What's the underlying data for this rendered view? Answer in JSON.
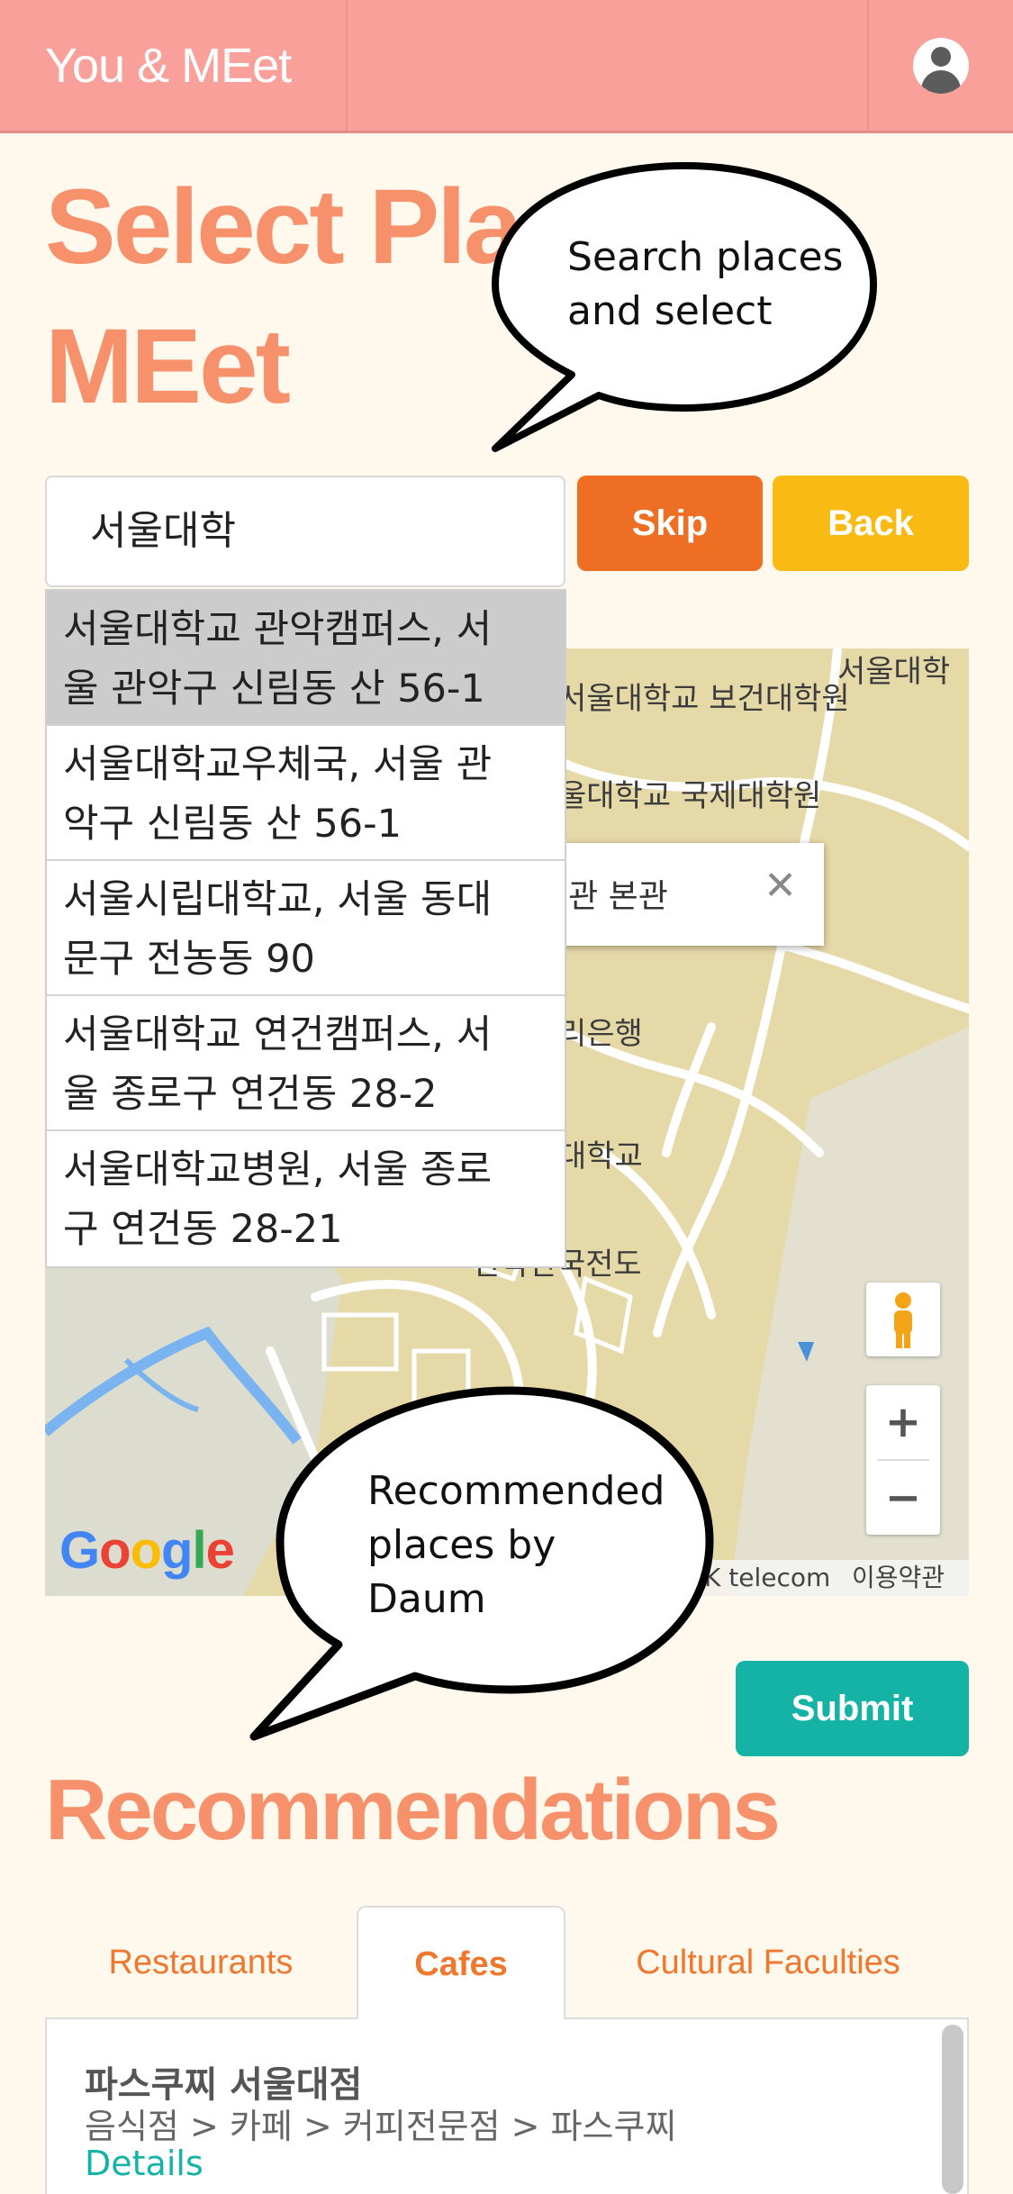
{
  "header": {
    "brand": "You & MEet",
    "user_icon": "user-avatar-icon"
  },
  "page_title": "Select Place to MEet",
  "page_title_visible_line1": "Select Plac",
  "page_title_visible_line2": "MEet",
  "callouts": {
    "search": "Search places and select",
    "search_line1": "Search places",
    "search_line2": "and select",
    "recommend_line1": "Recommended",
    "recommend_line2": "places by",
    "recommend_line3": "Daum"
  },
  "search": {
    "value": "서울대학",
    "skip_label": "Skip",
    "back_label": "Back"
  },
  "suggestions": [
    {
      "line1": "서울대학교 관악캠퍼스, 서",
      "line2": "울 관악구 신림동 산 56-1",
      "active": true
    },
    {
      "line1": "서울대학교우체국, 서울 관",
      "line2": "악구 신림동 산 56-1",
      "active": false
    },
    {
      "line1": "서울시립대학교, 서울 동대",
      "line2": "문구 전농동 90",
      "active": false
    },
    {
      "line1": "서울대학교 연건캠퍼스, 서",
      "line2": "울 종로구 연건동 28-2",
      "active": false
    },
    {
      "line1": "서울대학교병원, 서울 종로",
      "line2": "구 연건동 28-21",
      "active": false
    }
  ],
  "map": {
    "labels": {
      "top_right": "서울대학",
      "grad_health": "서울대학교 보건대학원",
      "grad_intl": "울대학교 국제대학원",
      "bank": "리은행",
      "univ": "대학교",
      "road": "관악산국전도"
    },
    "info_window_text": "시관 본관",
    "info_close": "✕",
    "zoom_in": "+",
    "zoom_out": "−",
    "google": "Google",
    "attribution": "K telecom",
    "terms": "이용약관",
    "colors": {
      "land": "#e6d9a8",
      "road": "#ffffff",
      "green": "#d9dccf",
      "water": "#7ab4f0"
    }
  },
  "submit_label": "Submit",
  "recommendations": {
    "title": "Recommendations",
    "tabs": [
      "Restaurants",
      "Cafes",
      "Cultural Faculties"
    ],
    "active_tab": "Cafes",
    "items": [
      {
        "name": "파스쿠찌 서울대점",
        "category": "음식점 > 카페 > 커피전문점 > 파스쿠찌",
        "link": "Details"
      }
    ]
  },
  "colors": {
    "header": "#f9a09b",
    "title": "#f7916b",
    "skip": "#ee6f24",
    "back": "#f8ba13",
    "submit": "#14b3a6",
    "background": "#fff8ec"
  }
}
